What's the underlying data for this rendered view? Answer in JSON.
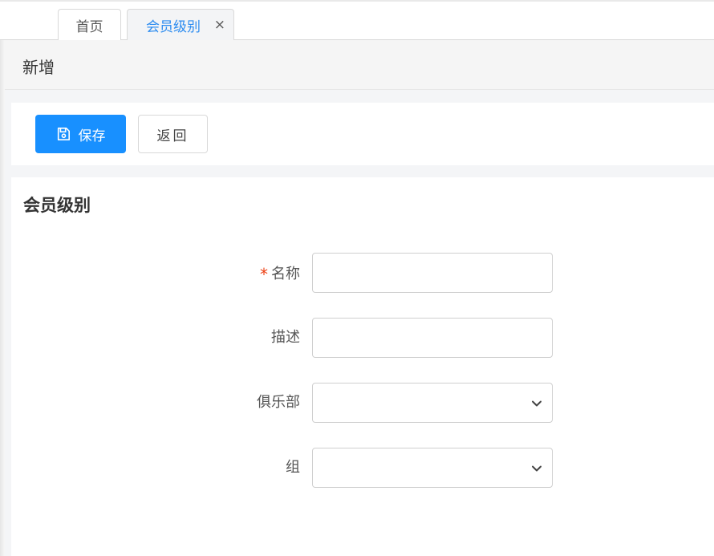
{
  "tabs": [
    {
      "label": "首页",
      "active": false
    },
    {
      "label": "会员级别",
      "active": true,
      "close": "×"
    }
  ],
  "page": {
    "title": "新增"
  },
  "toolbar": {
    "save_label": "保存",
    "back_label": "返回",
    "icons": {
      "save": "floppy-disk-icon"
    }
  },
  "form": {
    "section_title": "会员级别",
    "required_mark": "*",
    "fields": {
      "name": {
        "label": "名称",
        "value": "",
        "required": true
      },
      "description": {
        "label": "描述",
        "value": ""
      },
      "club": {
        "label": "俱乐部",
        "value": ""
      },
      "group": {
        "label": "组",
        "value": ""
      }
    }
  },
  "colors": {
    "primary": "#1890ff",
    "active_tab_text": "#2d8cf0",
    "required": "#ed4014",
    "border": "#d9d9d9"
  }
}
